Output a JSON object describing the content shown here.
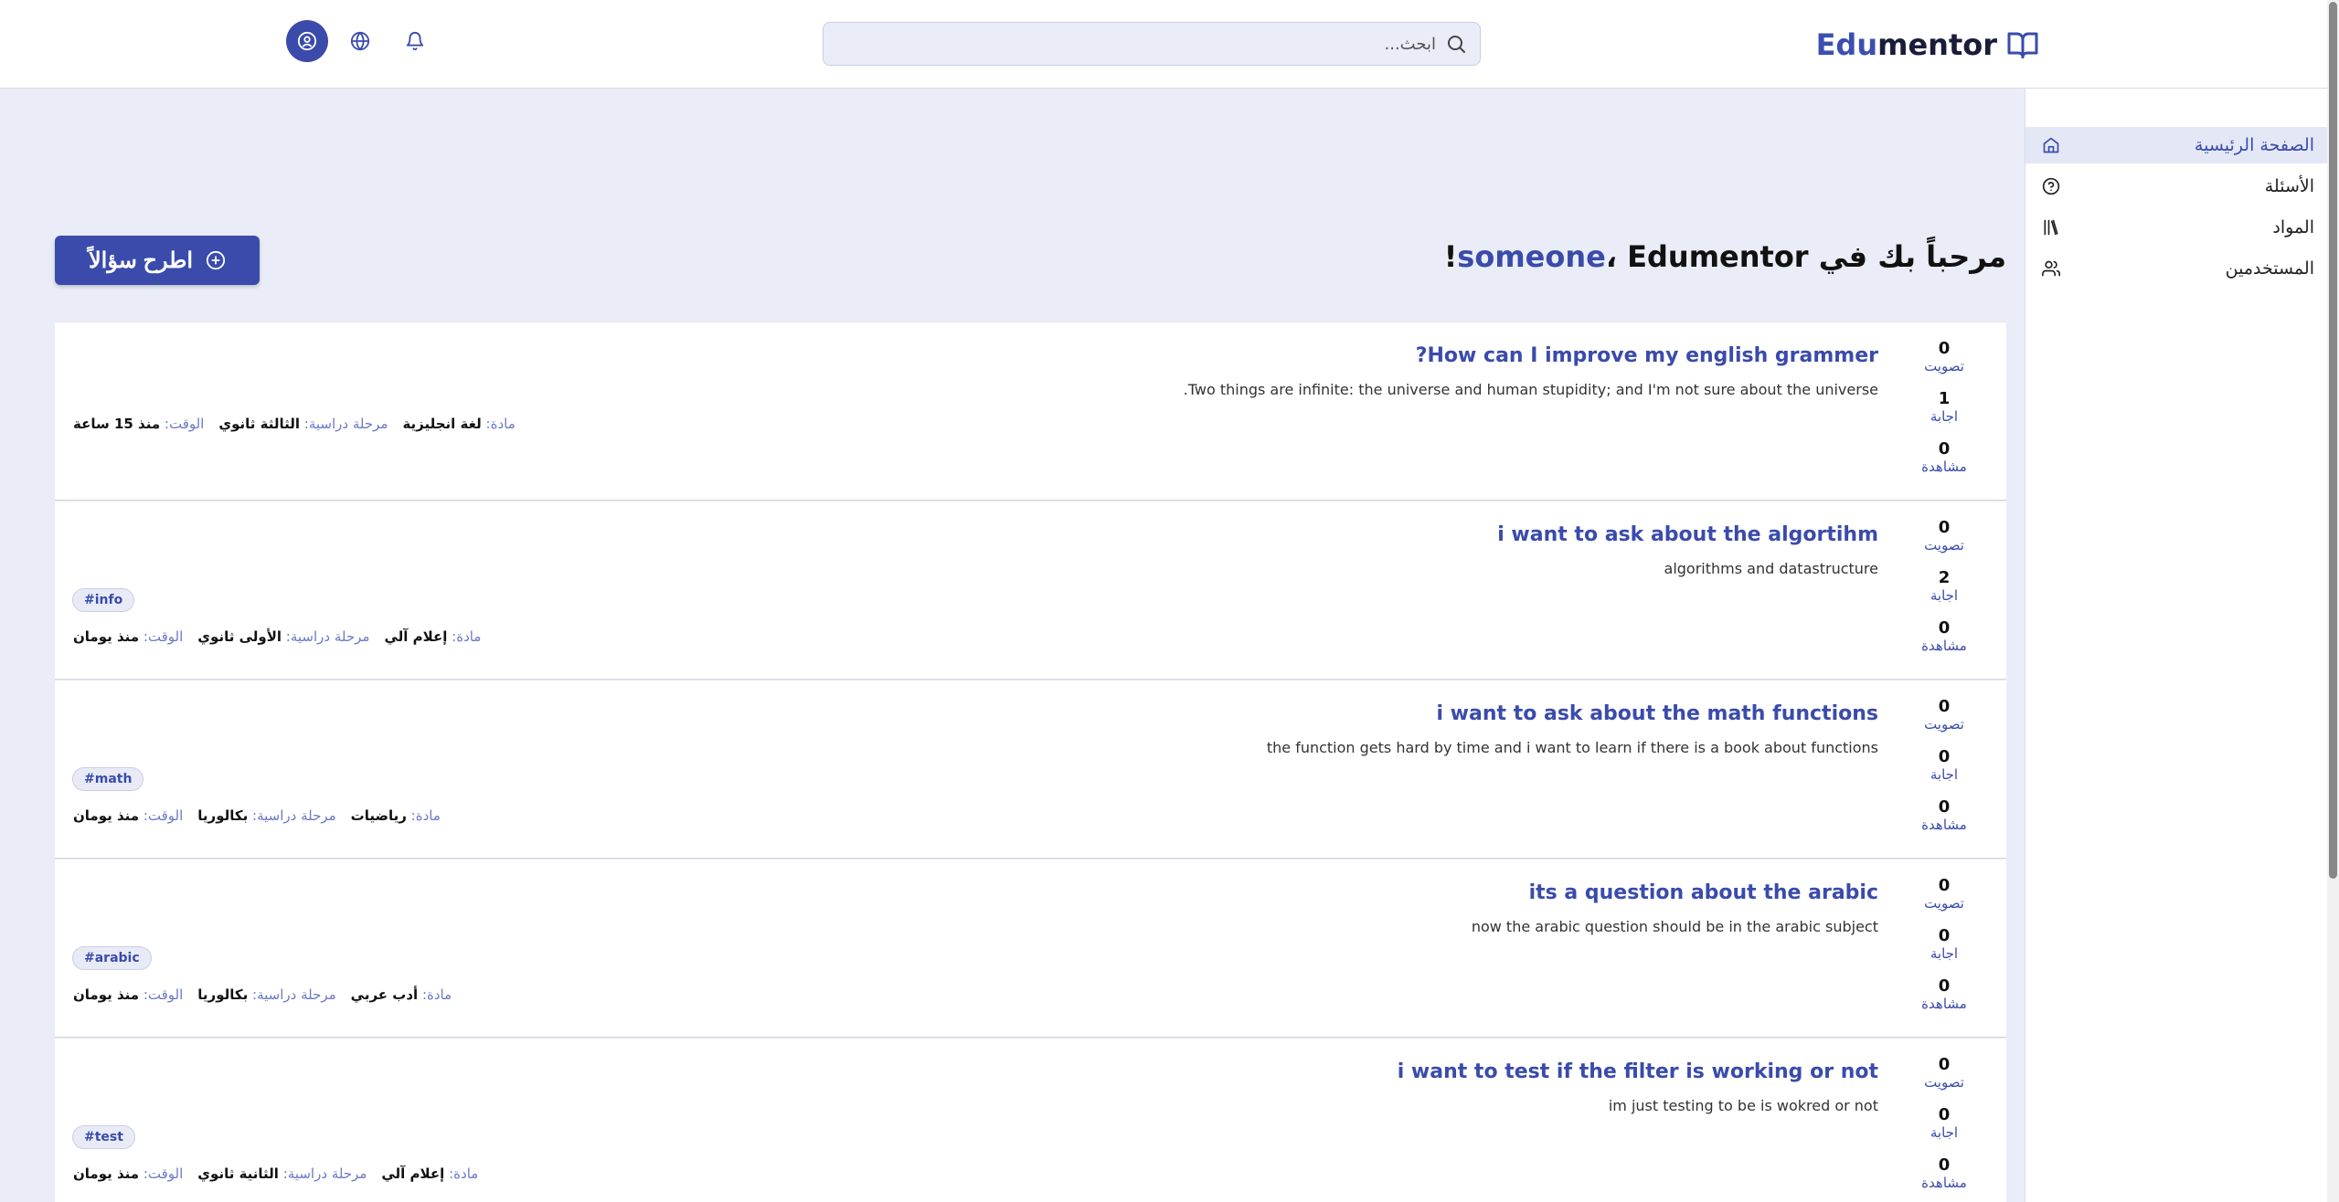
{
  "header": {
    "logo_prefix": "Edu",
    "logo_suffix": "mentor",
    "search_placeholder": "ابحث..."
  },
  "sidebar": {
    "items": [
      {
        "label": "الصفحة الرئيسية",
        "icon": "home-icon",
        "active": true
      },
      {
        "label": "الأسئلة",
        "icon": "question-circle-icon",
        "active": false
      },
      {
        "label": "المواد",
        "icon": "books-icon",
        "active": false
      },
      {
        "label": "المستخدمين",
        "icon": "users-icon",
        "active": false
      }
    ]
  },
  "main": {
    "welcome_prefix": "مرحباً بك في ",
    "welcome_user": "someone",
    "welcome_suffix": "، Edumentor!",
    "ask_button": "اطرح سؤالاً"
  },
  "stat_labels": {
    "votes": "تصويت",
    "answers": "اجابة",
    "views": "مشاهدة"
  },
  "meta_labels": {
    "subject": "مادة:",
    "stage": "مرحلة دراسية:",
    "time": "الوقت:"
  },
  "questions": [
    {
      "votes": "0",
      "answers": "1",
      "views": "0",
      "title": "How can I improve my english grammer?",
      "body": "Two things are infinite: the universe and human stupidity; and I'm not sure about the universe.",
      "tag": "",
      "subject": "لغة انجليزية",
      "stage": "الثالثة ثانوي",
      "time": "منذ 15 ساعة"
    },
    {
      "votes": "0",
      "answers": "2",
      "views": "0",
      "title": "i want to ask about the algortihm",
      "body": "algorithms and datastructure",
      "tag": "#info",
      "subject": "إعلام آلي",
      "stage": "الأولى ثانوي",
      "time": "منذ يومان"
    },
    {
      "votes": "0",
      "answers": "0",
      "views": "0",
      "title": "i want to ask about the math functions",
      "body": "the function gets hard by time and i want to learn if there is a book about functions",
      "tag": "#math",
      "subject": "رياضيات",
      "stage": "بكالوريا",
      "time": "منذ يومان"
    },
    {
      "votes": "0",
      "answers": "0",
      "views": "0",
      "title": "its a question about the arabic",
      "body": "now the arabic question should be in the arabic subject",
      "tag": "#arabic",
      "subject": "أدب عربي",
      "stage": "بكالوريا",
      "time": "منذ يومان"
    },
    {
      "votes": "0",
      "answers": "0",
      "views": "0",
      "title": "i want to test if the filter is working or not",
      "body": "im just testing to be is wokred or not",
      "tag": "#test",
      "subject": "إعلام آلي",
      "stage": "الثانية ثانوي",
      "time": "منذ يومان"
    }
  ]
}
